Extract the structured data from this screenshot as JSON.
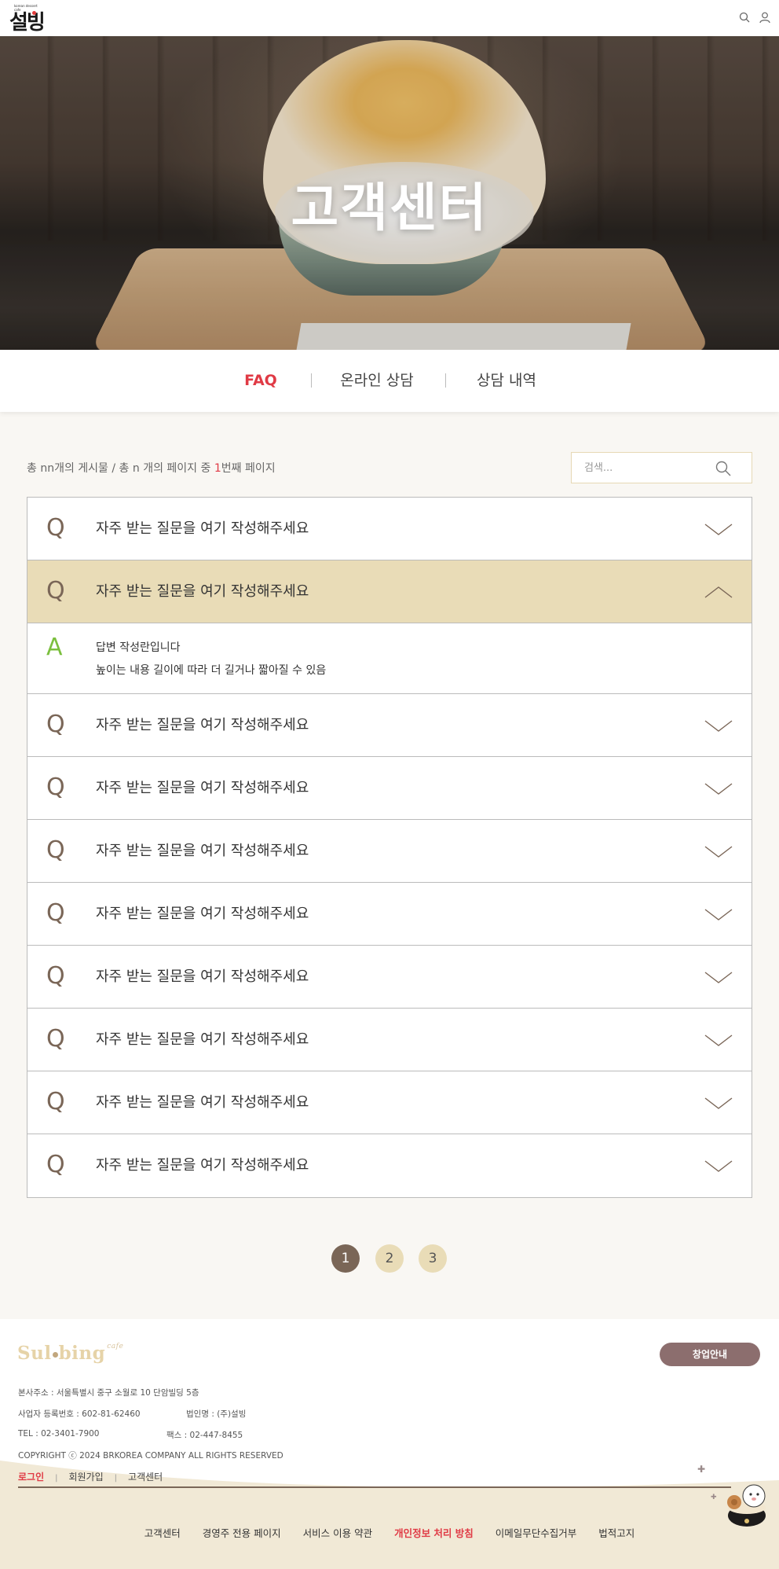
{
  "header": {
    "logo_tiny": "korean dessert cafe",
    "logo_text": "설빙"
  },
  "hero": {
    "title": "고객센터"
  },
  "tabs": [
    {
      "label": "FAQ",
      "active": true
    },
    {
      "label": "온라인 상담",
      "active": false
    },
    {
      "label": "상담 내역",
      "active": false
    }
  ],
  "meta": {
    "prefix": "총 nn개의 게시물 / 총 n 개의 페이지 중 ",
    "current": "1",
    "suffix": "번째 페이지"
  },
  "search": {
    "placeholder": "검색..."
  },
  "faq": {
    "q_letter": "Q",
    "a_letter": "A",
    "items": [
      {
        "question": "자주 받는 질문을 여기 작성해주세요",
        "open": false
      },
      {
        "question": "자주 받는 질문을 여기 작성해주세요",
        "open": true
      },
      {
        "question": "자주 받는 질문을 여기 작성해주세요",
        "open": false
      },
      {
        "question": "자주 받는 질문을 여기 작성해주세요",
        "open": false
      },
      {
        "question": "자주 받는 질문을 여기 작성해주세요",
        "open": false
      },
      {
        "question": "자주 받는 질문을 여기 작성해주세요",
        "open": false
      },
      {
        "question": "자주 받는 질문을 여기 작성해주세요",
        "open": false
      },
      {
        "question": "자주 받는 질문을 여기 작성해주세요",
        "open": false
      },
      {
        "question": "자주 받는 질문을 여기 작성해주세요",
        "open": false
      },
      {
        "question": "자주 받는 질문을 여기 작성해주세요",
        "open": false
      }
    ],
    "answer": {
      "line1": "답변 작성란입니다",
      "line2": "높이는 내용 길이에 따라 더 길거나 짧아질 수 있음"
    }
  },
  "pagination": {
    "pages": [
      "1",
      "2",
      "3"
    ],
    "current": "1"
  },
  "footer": {
    "logo_left": "Sul",
    "logo_right": "bing",
    "logo_small": "cafe",
    "startup_button": "창업안내",
    "address": "본사주소 : 서울특별시 중구 소월로 10 단암빌딩 5층",
    "business_no": "사업자 등록번호 : 602-81-62460",
    "corp_name": "법인명 : (주)설빙",
    "tel": "TEL : 02-3401-7900",
    "fax": "팩스 : 02-447-8455",
    "copyright": "COPYRIGHT ⓒ 2024 BRKOREA COMPANY ALL RIGHTS RESERVED",
    "small_links": {
      "login": "로그인",
      "signup": "회원가입",
      "support": "고객센터",
      "sep": "|"
    },
    "bottom_links": [
      {
        "label": "고객센터",
        "highlight": false
      },
      {
        "label": "경영주 전용 페이지",
        "highlight": false
      },
      {
        "label": "서비스 이용 약관",
        "highlight": false
      },
      {
        "label": "개인정보 처리 방침",
        "highlight": true
      },
      {
        "label": "이메일무단수집거부",
        "highlight": false
      },
      {
        "label": "법적고지",
        "highlight": false
      }
    ]
  },
  "colors": {
    "accent_red": "#e03a45",
    "brown": "#7a6657",
    "beige": "#e9dcb7",
    "answer_green": "#7bbf3e"
  }
}
